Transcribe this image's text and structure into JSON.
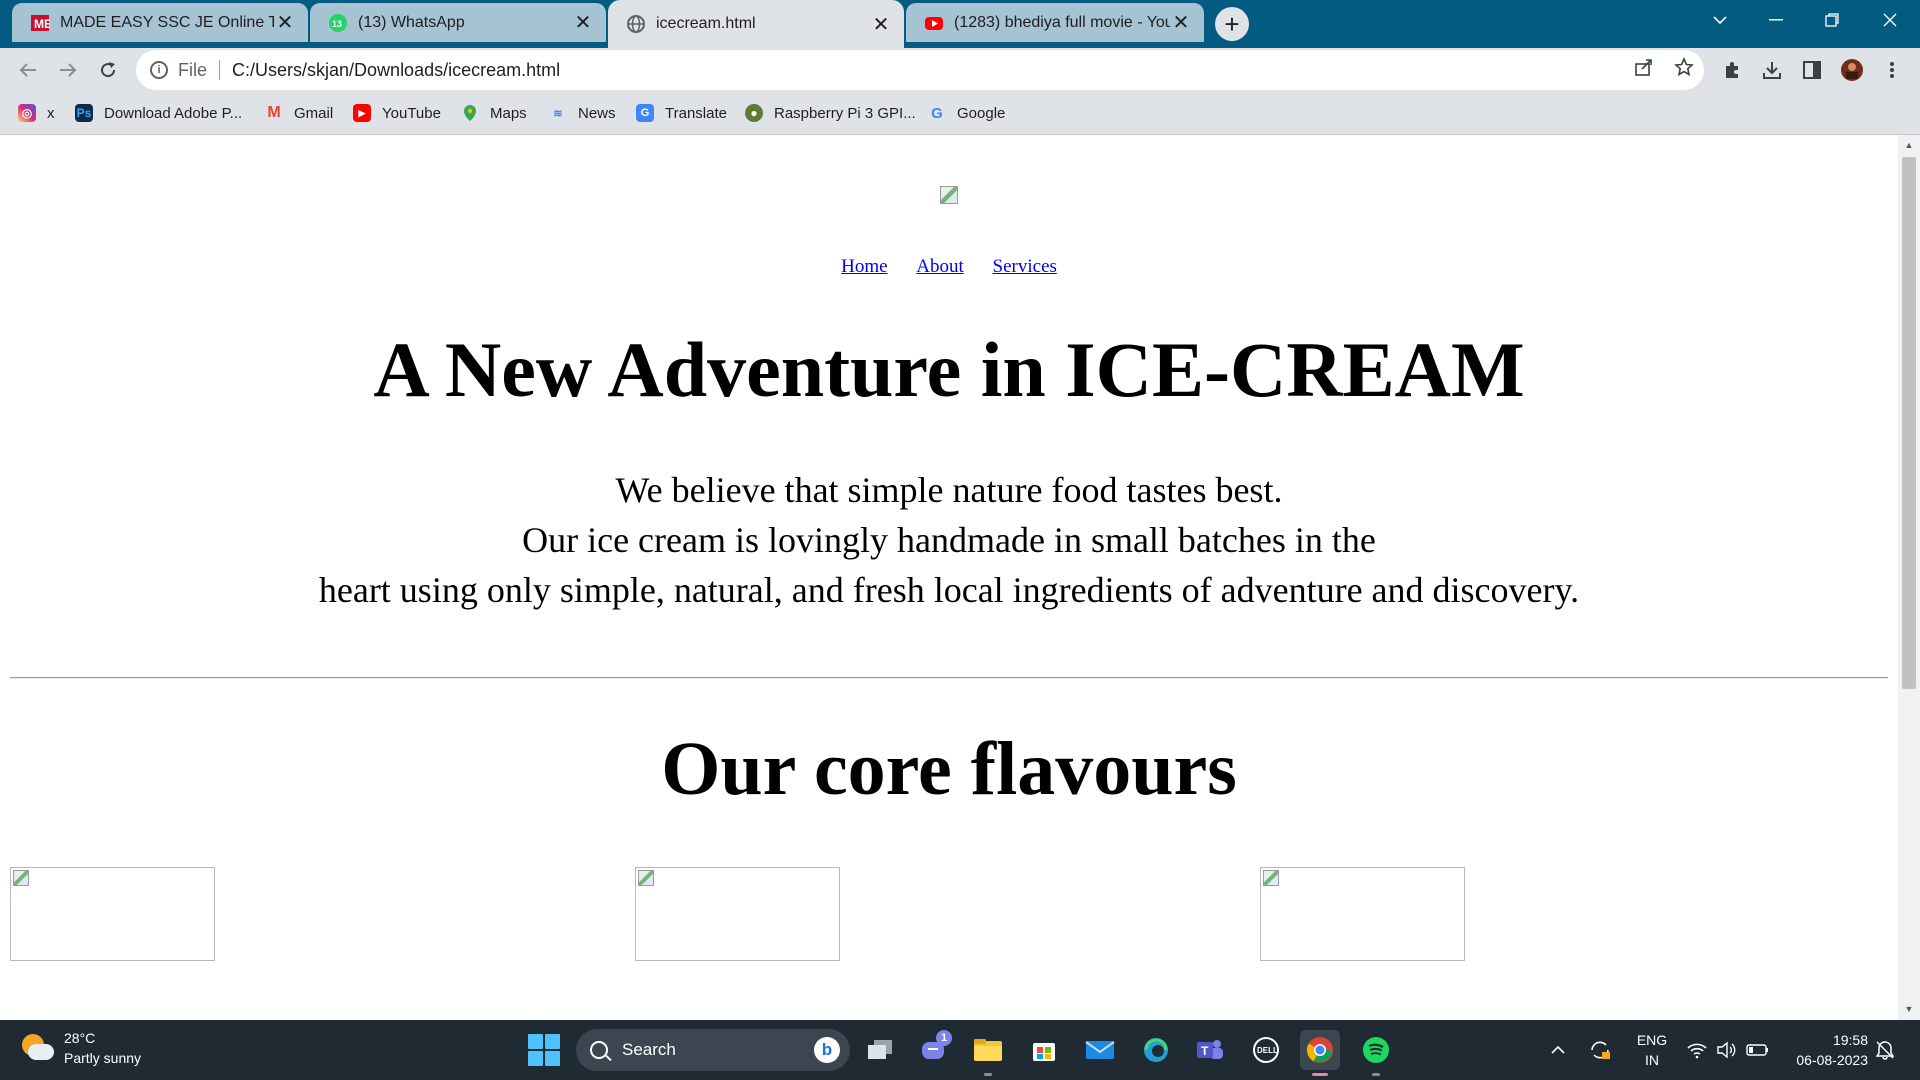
{
  "browser": {
    "tabs": [
      {
        "title": "MADE EASY SSC JE Online Test Se",
        "favicon": "made-easy-icon",
        "active": false
      },
      {
        "title": "(13) WhatsApp",
        "favicon": "whatsapp-icon",
        "badge": "13",
        "active": false
      },
      {
        "title": "icecream.html",
        "favicon": "globe-icon",
        "active": true
      },
      {
        "title": "(1283) bhediya full movie - YouTu",
        "favicon": "youtube-icon",
        "active": false
      }
    ],
    "address": {
      "scheme": "File",
      "url": "C:/Users/skjan/Downloads/icecream.html"
    },
    "bookmarks": [
      {
        "label": "x",
        "icon": "instagram-icon",
        "color": "#d6249f"
      },
      {
        "label": "Download Adobe P...",
        "icon": "adobe-photoshop-icon",
        "color": "#0d2a4a"
      },
      {
        "label": "Gmail",
        "icon": "gmail-icon",
        "color": "#ea4335"
      },
      {
        "label": "YouTube",
        "icon": "youtube-icon",
        "color": "#ff0000"
      },
      {
        "label": "Maps",
        "icon": "maps-icon",
        "color": "#34a853"
      },
      {
        "label": "News",
        "icon": "news-icon",
        "color": "#4285f4"
      },
      {
        "label": "Translate",
        "icon": "translate-icon",
        "color": "#4285f4"
      },
      {
        "label": "Raspberry Pi 3 GPI...",
        "icon": "raspberry-pi-icon",
        "color": "#5d7a3a"
      },
      {
        "label": "Google",
        "icon": "google-icon",
        "color": "#4285f4"
      }
    ]
  },
  "page": {
    "nav": [
      "Home",
      "About",
      "Services"
    ],
    "hero_title": "A New Adventure in ICE-CREAM",
    "hero_lines": [
      "We believe that simple nature food tastes best.",
      "Our ice cream is lovingly handmade in small batches in the",
      "heart using only simple, natural, and fresh local ingredients of adventure and discovery."
    ],
    "section_title": "Our core flavours"
  },
  "taskbar": {
    "weather_temp": "28°C",
    "weather_desc": "Partly sunny",
    "search_label": "Search",
    "chat_badge": "1",
    "lang_top": "ENG",
    "lang_bottom": "IN",
    "time": "19:58",
    "date": "06-08-2023"
  }
}
